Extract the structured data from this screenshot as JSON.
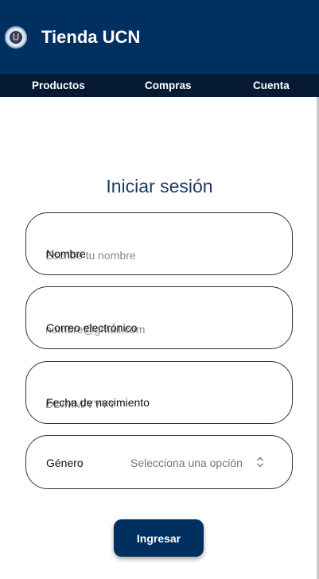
{
  "header": {
    "title": "Tienda UCN",
    "logo_letter": "U",
    "color": "#00305f"
  },
  "nav": {
    "items": [
      {
        "label": "Productos"
      },
      {
        "label": "Compras"
      },
      {
        "label": "Cuenta"
      }
    ]
  },
  "form": {
    "title": "Iniciar sesión",
    "fields": [
      {
        "label": "Nombre",
        "placeholder": "Escribe tu nombre",
        "value": ""
      },
      {
        "label": "Correo electrónico",
        "placeholder": "nombre@gmail.com",
        "value": ""
      },
      {
        "label": "Fecha de nacimiento",
        "placeholder": "DD/MM/YYYY",
        "value": ""
      }
    ],
    "gender": {
      "label": "Género",
      "selected": "Selecciona una opción",
      "icon": "chevron-updown-icon"
    },
    "submit_label": "Ingresar"
  }
}
